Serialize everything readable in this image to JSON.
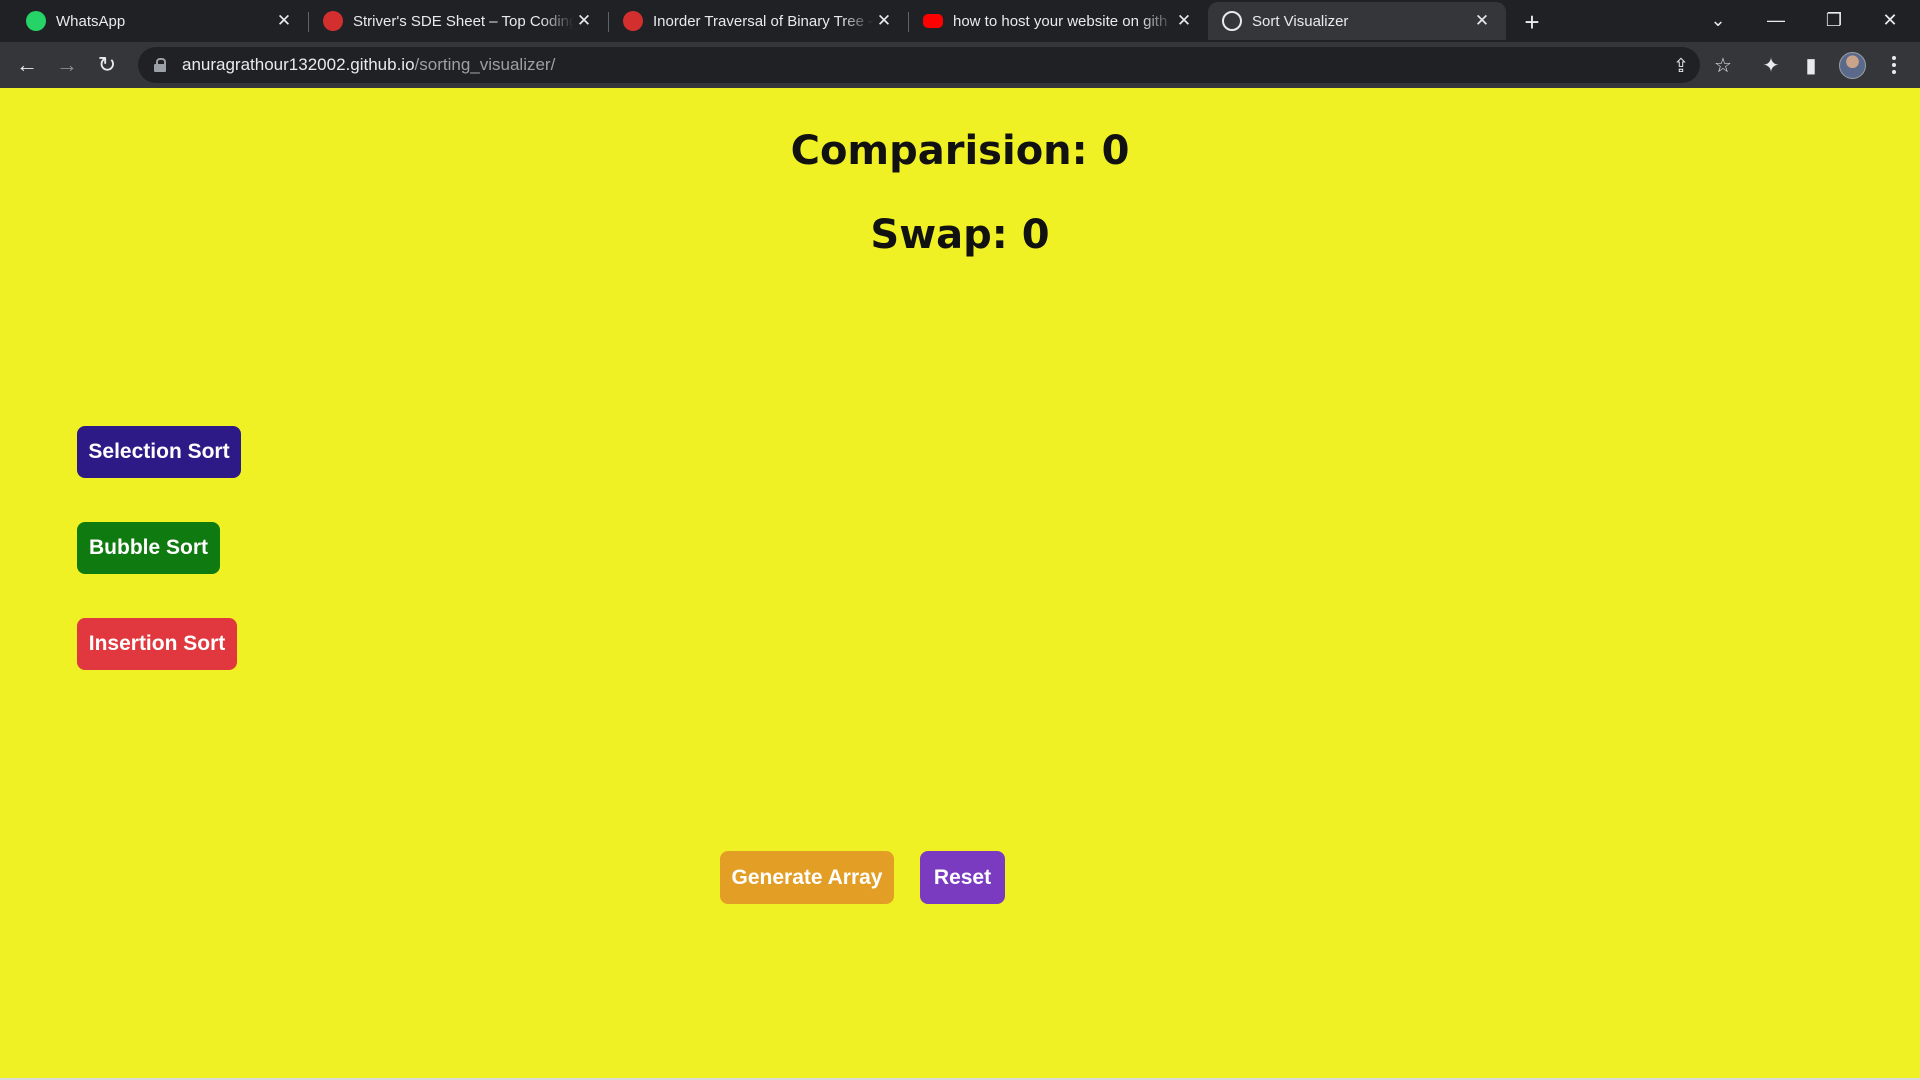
{
  "browser": {
    "tabs": [
      {
        "title": "WhatsApp",
        "icon": "whatsapp-icon",
        "active": false
      },
      {
        "title": "Striver's SDE Sheet – Top Coding",
        "icon": "takeuforward-icon",
        "active": false
      },
      {
        "title": "Inorder Traversal of Binary Tree -",
        "icon": "takeuforward-icon",
        "active": false
      },
      {
        "title": "how to host your website on gith",
        "icon": "youtube-icon",
        "active": false
      },
      {
        "title": "Sort Visualizer",
        "icon": "globe-icon",
        "active": true
      }
    ],
    "address": {
      "host": "anuragrathour132002.github.io",
      "path": "/sorting_visualizer/"
    }
  },
  "page": {
    "background": "#eff124",
    "comparisons_text": "Comparision: 0",
    "swaps_text": "Swap: 0",
    "sort_buttons": [
      {
        "label": "Selection Sort",
        "color": "#2e1a87"
      },
      {
        "label": "Bubble Sort",
        "color": "#0f7a0f"
      },
      {
        "label": "Insertion Sort",
        "color": "#e0383e"
      }
    ],
    "generate_label": "Generate Array",
    "generate_color": "#e39e26",
    "reset_label": "Reset",
    "reset_color": "#7b3bc0"
  }
}
